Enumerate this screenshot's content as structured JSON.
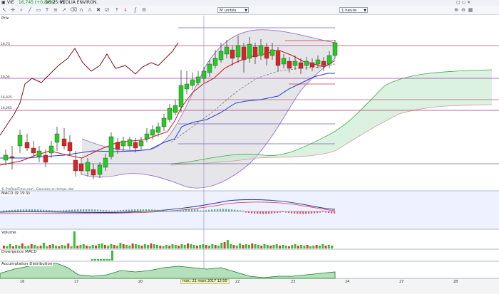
{
  "header": {
    "symbol": "VIE",
    "quote": "16,745 (+0,84%)",
    "time": "16:25:05",
    "name": "VEOLIA ENVIRON."
  },
  "toolbar": {
    "units_select": "M unités",
    "period_select": "1 heure"
  },
  "panels": {
    "price_title": "Prix",
    "macd_title": "MACD (9 19 9)",
    "volume_title": "Volume",
    "divergence_title": "Divergence MACD",
    "accumulation_title": "Accumulation Distribution"
  },
  "price_levels": [
    "16,73",
    "16,54",
    "16,425",
    "16,265"
  ],
  "x_axis": {
    "labels": [
      "16",
      "17",
      "20",
      "22",
      "23",
      "24",
      "27",
      "28"
    ],
    "crosshair_label": "mar., 21 mars 2017 12:00"
  },
  "copyright": "© ProRealTime.com . Données en temps réel",
  "colors": {
    "up": "#22cc22",
    "down": "#dd2222",
    "kijun": "#cc1111",
    "tenkan": "#1f3fd0",
    "bollinger": "#9a70c8",
    "close_line": "#7a1010",
    "cloud": "#bfe8c6"
  }
}
